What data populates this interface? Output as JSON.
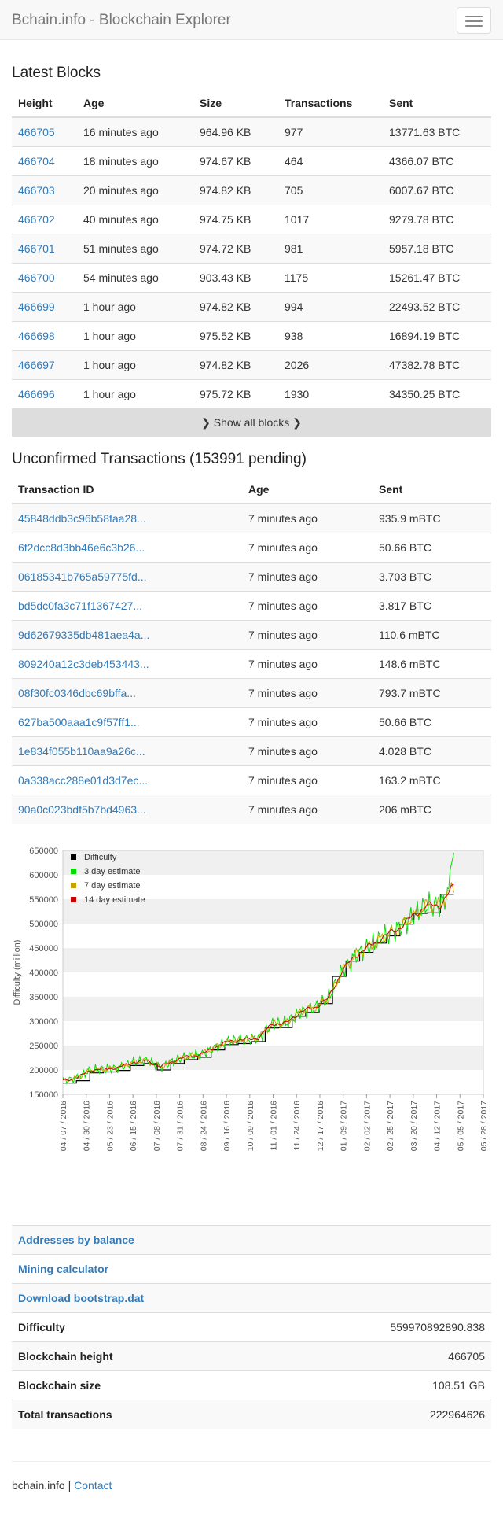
{
  "nav": {
    "brand": "Bchain.info - Blockchain Explorer"
  },
  "blocks": {
    "title": "Latest Blocks",
    "headers": [
      "Height",
      "Age",
      "Size",
      "Transactions",
      "Sent"
    ],
    "rows": [
      [
        "466705",
        "16 minutes ago",
        "964.96 KB",
        "977",
        "13771.63 BTC"
      ],
      [
        "466704",
        "18 minutes ago",
        "974.67 KB",
        "464",
        "4366.07 BTC"
      ],
      [
        "466703",
        "20 minutes ago",
        "974.82 KB",
        "705",
        "6007.67 BTC"
      ],
      [
        "466702",
        "40 minutes ago",
        "974.75 KB",
        "1017",
        "9279.78 BTC"
      ],
      [
        "466701",
        "51 minutes ago",
        "974.72 KB",
        "981",
        "5957.18 BTC"
      ],
      [
        "466700",
        "54 minutes ago",
        "903.43 KB",
        "1175",
        "15261.47 BTC"
      ],
      [
        "466699",
        "1 hour ago",
        "974.82 KB",
        "994",
        "22493.52 BTC"
      ],
      [
        "466698",
        "1 hour ago",
        "975.52 KB",
        "938",
        "16894.19 BTC"
      ],
      [
        "466697",
        "1 hour ago",
        "974.82 KB",
        "2026",
        "47382.78 BTC"
      ],
      [
        "466696",
        "1 hour ago",
        "975.72 KB",
        "1930",
        "34350.25 BTC"
      ]
    ],
    "show_all": "Show all blocks"
  },
  "unconfirmed": {
    "title": "Unconfirmed Transactions (153991 pending)",
    "headers": [
      "Transaction ID",
      "Age",
      "Sent"
    ],
    "rows": [
      [
        "45848ddb3c96b58faa28...",
        "7 minutes ago",
        "935.9 mBTC"
      ],
      [
        "6f2dcc8d3bb46e6c3b26...",
        "7 minutes ago",
        "50.66 BTC"
      ],
      [
        "06185341b765a59775fd...",
        "7 minutes ago",
        "3.703 BTC"
      ],
      [
        "bd5dc0fa3c71f1367427...",
        "7 minutes ago",
        "3.817 BTC"
      ],
      [
        "9d62679335db481aea4a...",
        "7 minutes ago",
        "110.6 mBTC"
      ],
      [
        "809240a12c3deb453443...",
        "7 minutes ago",
        "148.6 mBTC"
      ],
      [
        "08f30fc0346dbc69bffa...",
        "7 minutes ago",
        "793.7 mBTC"
      ],
      [
        "627ba500aaa1c9f57ff1...",
        "7 minutes ago",
        "50.66 BTC"
      ],
      [
        "1e834f055b110aa9a26c...",
        "7 minutes ago",
        "4.028 BTC"
      ],
      [
        "0a338acc288e01d3d7ec...",
        "7 minutes ago",
        "163.2 mBTC"
      ],
      [
        "90a0c023bdf5b7bd4963...",
        "7 minutes ago",
        "206 mBTC"
      ]
    ]
  },
  "chart_data": {
    "type": "line",
    "ylabel": "Difficulty (million)",
    "ylim": [
      150000,
      650000
    ],
    "yticks": [
      "150000",
      "200000",
      "250000",
      "300000",
      "350000",
      "400000",
      "450000",
      "500000",
      "550000",
      "600000",
      "650000"
    ],
    "xticks": [
      "04 / 07 / 2016",
      "04 / 30 / 2016",
      "05 / 23 / 2016",
      "06 / 15 / 2016",
      "07 / 08 / 2016",
      "07 / 31 / 2016",
      "08 / 24 / 2016",
      "09 / 16 / 2016",
      "10 / 09 / 2016",
      "11 / 01 / 2016",
      "11 / 24 / 2016",
      "12 / 17 / 2016",
      "01 / 09 / 2017",
      "02 / 02 / 2017",
      "02 / 25 / 2017",
      "03 / 20 / 2017",
      "04 / 12 / 2017",
      "05 / 05 / 2017",
      "05 / 28 / 2017"
    ],
    "grid": "horizontal alternating bands",
    "legend_position": "top-left",
    "series": [
      {
        "name": "Difficulty",
        "color": "#000000",
        "steps": [
          173000,
          178000,
          194000,
          196000,
          199000,
          209000,
          213000,
          200000,
          213000,
          221000,
          226000,
          241000,
          252000,
          254000,
          258000,
          286000,
          287000,
          310000,
          318000,
          336000,
          392000,
          423000,
          441000,
          460000,
          475000,
          499000,
          521000,
          522000,
          560000
        ]
      },
      {
        "name": "3 day estimate",
        "color": "#00dd00"
      },
      {
        "name": "7 day estimate",
        "color": "#c8a000"
      },
      {
        "name": "14 day estimate",
        "color": "#cc0000"
      }
    ],
    "final_3day_peak": 645000
  },
  "stats": {
    "links": [
      "Addresses by balance",
      "Mining calculator",
      "Download bootstrap.dat"
    ],
    "rows": [
      {
        "label": "Difficulty",
        "value": "559970892890.838"
      },
      {
        "label": "Blockchain height",
        "value": "466705"
      },
      {
        "label": "Blockchain size",
        "value": "108.51 GB"
      },
      {
        "label": "Total transactions",
        "value": "222964626"
      }
    ]
  },
  "footer": {
    "site": "bchain.info",
    "separator": "|",
    "contact": "Contact"
  }
}
